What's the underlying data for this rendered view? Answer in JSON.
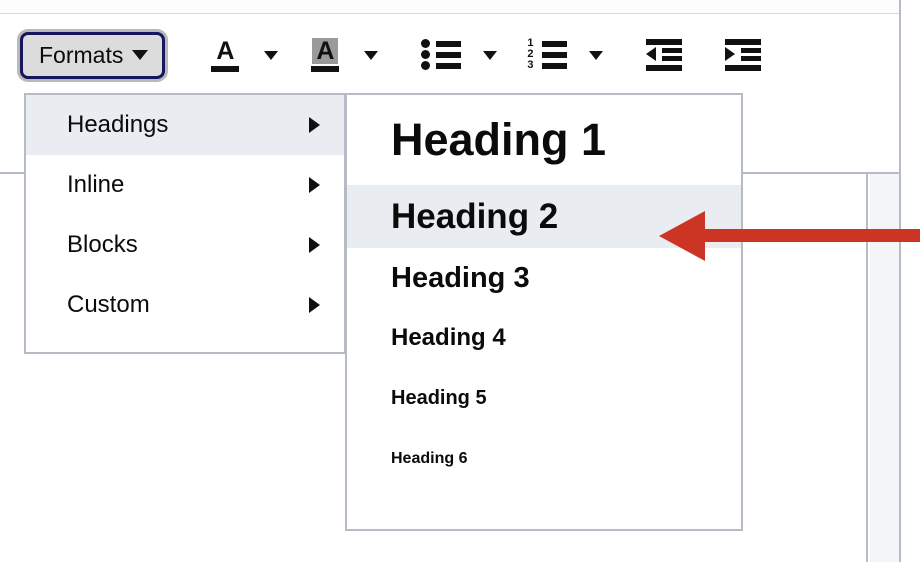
{
  "app": {
    "accent_red": "#CC3524",
    "menu_border_color": "#B6BCC6",
    "menu_highlight_color": "#E9EDF2",
    "button_face_color": "#DCDCDC",
    "focus_ring_color": "#16165C"
  },
  "toolbar": {
    "formats_button": {
      "label": "Formats",
      "caret_icon": "chevron-down-icon",
      "state": "focused-open"
    },
    "items": [
      {
        "icon": "text-color-icon",
        "glyph": "A",
        "caret_icon": "chevron-down-icon"
      },
      {
        "icon": "background-color-icon",
        "glyph": "A",
        "caret_icon": "chevron-down-icon"
      },
      {
        "icon": "bullet-list-icon",
        "caret_icon": "chevron-down-icon"
      },
      {
        "icon": "numbered-list-icon",
        "caret_icon": "chevron-down-icon",
        "numbers": [
          "1",
          "2",
          "3"
        ]
      },
      {
        "icon": "decrease-indent-icon"
      },
      {
        "icon": "increase-indent-icon"
      }
    ]
  },
  "formats_menu": {
    "items": [
      {
        "label": "Headings",
        "has_submenu": true,
        "active": true
      },
      {
        "label": "Inline",
        "has_submenu": true,
        "active": false
      },
      {
        "label": "Blocks",
        "has_submenu": true,
        "active": false
      },
      {
        "label": "Custom",
        "has_submenu": true,
        "active": false
      }
    ]
  },
  "headings_submenu": {
    "items": [
      {
        "label": "Heading 1",
        "level": 1,
        "active": false
      },
      {
        "label": "Heading 2",
        "level": 2,
        "active": true
      },
      {
        "label": "Heading 3",
        "level": 3,
        "active": false
      },
      {
        "label": "Heading 4",
        "level": 4,
        "active": false
      },
      {
        "label": "Heading 5",
        "level": 5,
        "active": false
      },
      {
        "label": "Heading 6",
        "level": 6,
        "active": false
      }
    ]
  },
  "annotation": {
    "type": "arrow",
    "direction": "left",
    "color": "#CC3524",
    "points_at": "Heading 2"
  }
}
